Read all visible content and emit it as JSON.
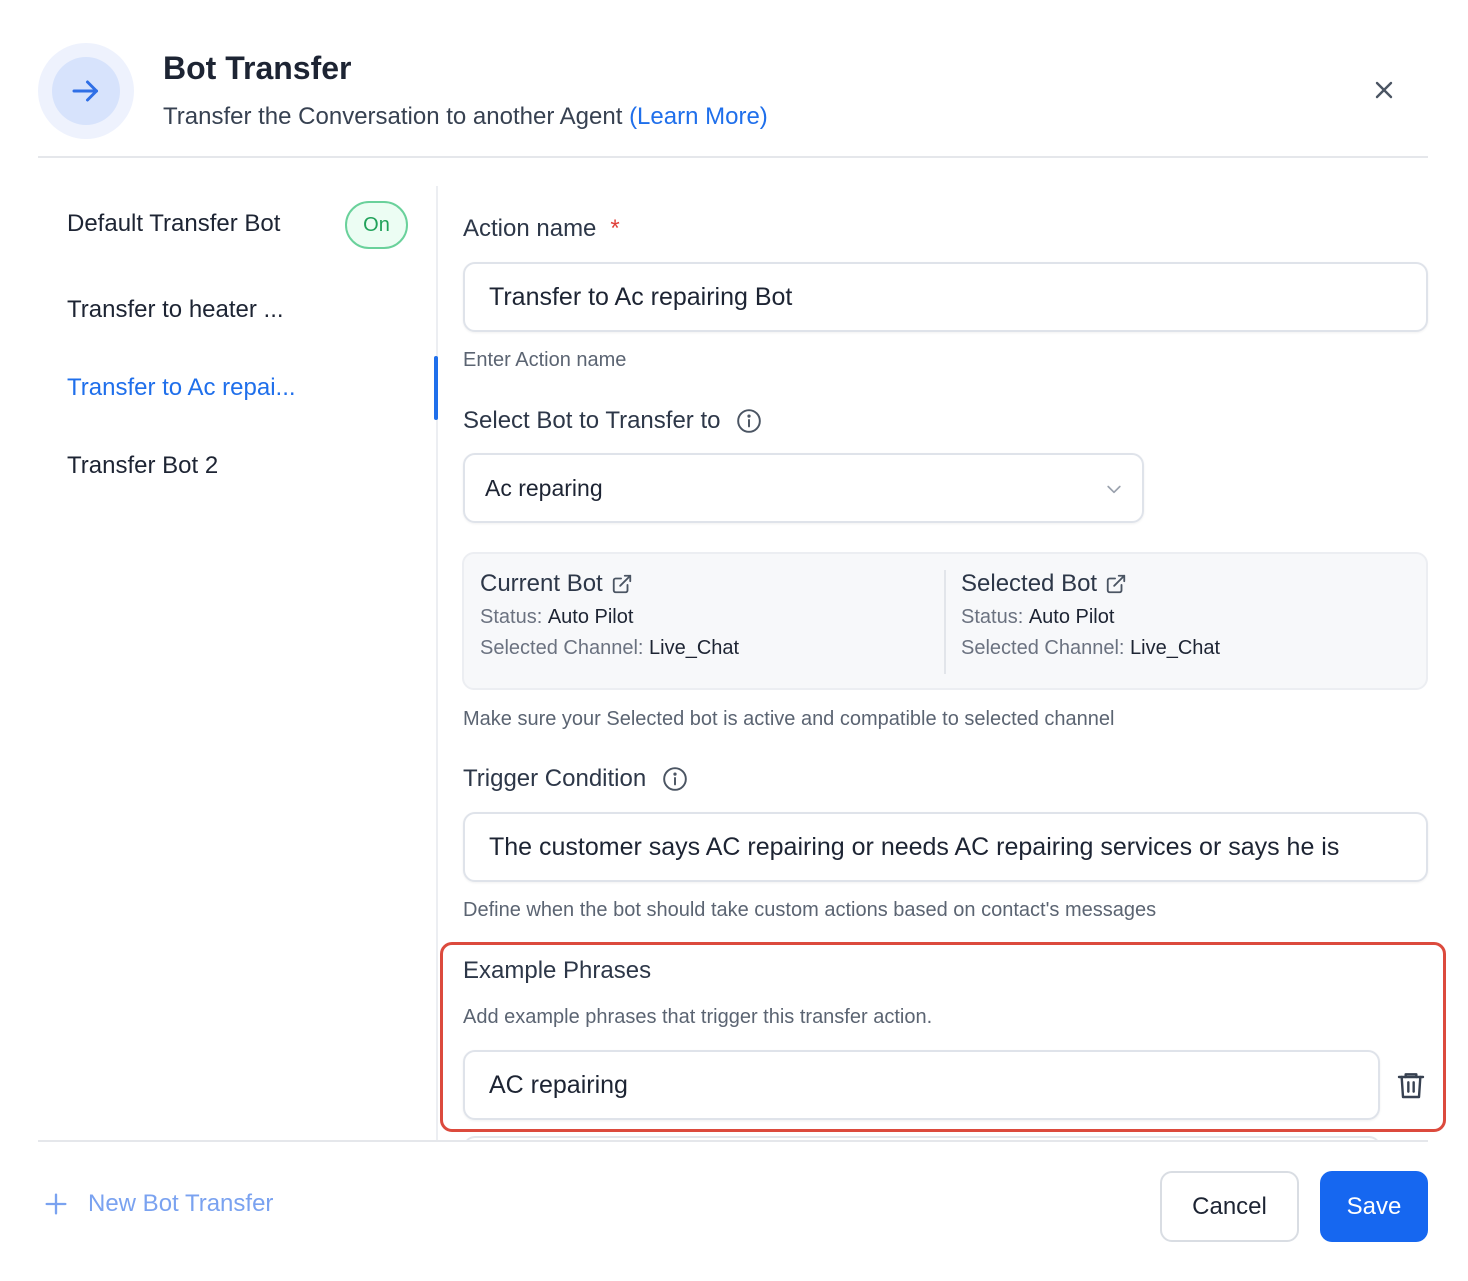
{
  "header": {
    "title": "Bot Transfer",
    "subtitle": "Transfer the Conversation to another Agent",
    "learn_more": "(Learn More)",
    "icon": "arrow-right-icon"
  },
  "sidebar": {
    "items": [
      {
        "label": "Default Transfer Bot",
        "badge": "On",
        "active": false
      },
      {
        "label": "Transfer to heater ...",
        "active": false
      },
      {
        "label": "Transfer to Ac repai...",
        "active": true
      },
      {
        "label": "Transfer Bot 2",
        "active": false
      }
    ],
    "new_label": "New Bot Transfer"
  },
  "form": {
    "action_name": {
      "label": "Action name",
      "required_mark": "*",
      "value": "Transfer to Ac repairing Bot",
      "hint": "Enter Action name"
    },
    "select_bot": {
      "label": "Select Bot to Transfer to",
      "value": "Ac reparing"
    },
    "current_bot": {
      "title": "Current Bot",
      "status_label": "Status:",
      "status": "Auto Pilot",
      "channel_label": "Selected Channel:",
      "channel": "Live_Chat"
    },
    "selected_bot": {
      "title": "Selected Bot",
      "status_label": "Status:",
      "status": "Auto Pilot",
      "channel_label": "Selected Channel:",
      "channel": "Live_Chat"
    },
    "compat_hint": "Make sure your Selected bot is active and compatible to selected channel",
    "trigger": {
      "label": "Trigger Condition",
      "value": "The customer says AC repairing or needs AC repairing services or says he is",
      "hint": "Define when the bot should take custom actions based on contact's messages"
    },
    "phrases": {
      "label": "Example Phrases",
      "hint": "Add example phrases that trigger this transfer action.",
      "items": [
        "AC repairing"
      ]
    }
  },
  "footer": {
    "cancel": "Cancel",
    "save": "Save"
  },
  "colors": {
    "accent": "#1667f0",
    "link": "#1f6feb",
    "on_badge": "#21a25a",
    "highlight": "#dc4a3d"
  }
}
